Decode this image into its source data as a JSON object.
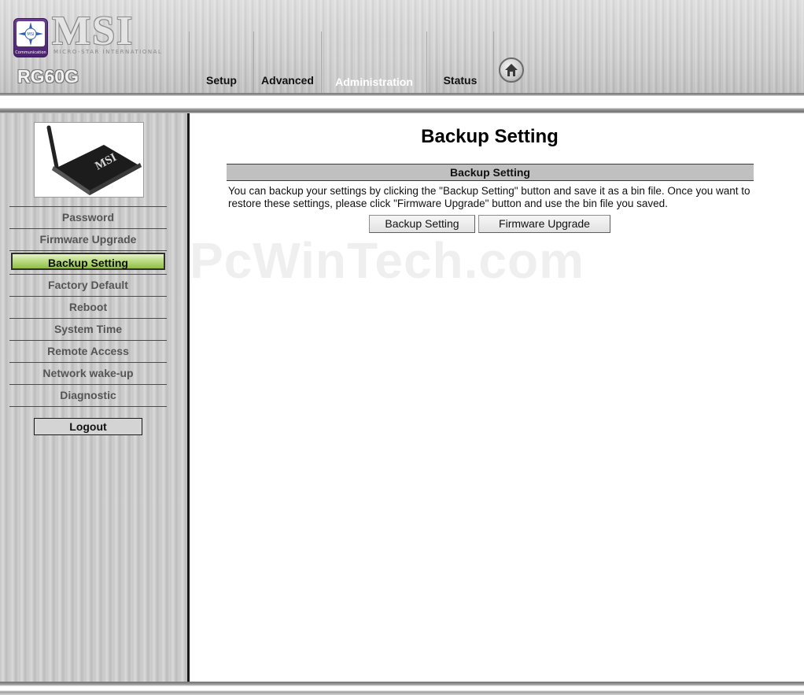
{
  "header": {
    "brand": "MSI",
    "brand_sub": "MICRO-STAR INTERNATIONAL",
    "logo_caption": "Communication",
    "model": "RG60G",
    "tabs": [
      {
        "label": "Setup",
        "active": false
      },
      {
        "label": "Advanced",
        "active": false
      },
      {
        "label": "Administration",
        "active": true
      },
      {
        "label": "Status",
        "active": false
      }
    ],
    "home_icon": "home-icon"
  },
  "sidebar": {
    "device_image": "router-photo",
    "device_label": "MSI",
    "items": [
      {
        "label": "Password",
        "active": false
      },
      {
        "label": "Firmware Upgrade",
        "active": false
      },
      {
        "label": "Backup Setting",
        "active": true
      },
      {
        "label": "Factory Default",
        "active": false
      },
      {
        "label": "Reboot",
        "active": false
      },
      {
        "label": "System Time",
        "active": false
      },
      {
        "label": "Remote Access",
        "active": false
      },
      {
        "label": "Network wake-up",
        "active": false
      },
      {
        "label": "Diagnostic",
        "active": false
      }
    ],
    "logout_label": "Logout"
  },
  "main": {
    "title": "Backup Setting",
    "section_title": "Backup Setting",
    "description": "You can backup your settings by clicking the \"Backup Setting\" button and save it as a bin file. Once you want to restore these settings, please click \"Firmware Upgrade\" button and use the bin file you saved.",
    "backup_button": "Backup Setting",
    "firmware_button": "Firmware Upgrade"
  },
  "watermark": "PcWinTech.com",
  "colors": {
    "active_menu": "#a6cc5f",
    "section_bar": "#c0c0c0"
  }
}
